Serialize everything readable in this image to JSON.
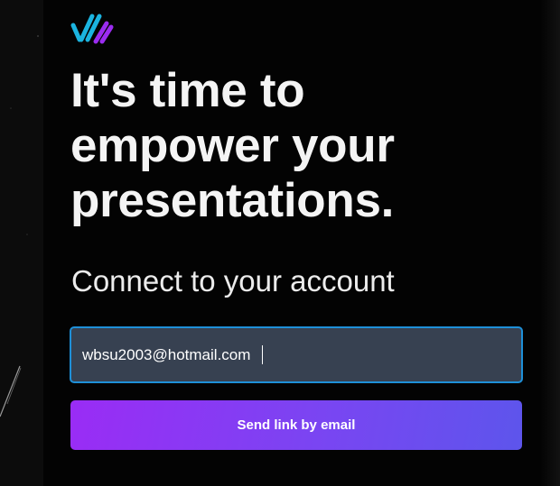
{
  "brand": {
    "logo_icon": "brand-stripes-logo-icon",
    "colors": {
      "primary_stripe": "#1bb4e0",
      "secondary_stripe": "#9b2cf0"
    }
  },
  "hero": {
    "headline_lines": [
      "It's time to",
      "empower your",
      "presentations."
    ]
  },
  "login": {
    "subtitle": "Connect to your account",
    "email_value": "wbsu2003@hotmail.com",
    "send_button_label": "Send link by email"
  },
  "colors": {
    "background": "#030303",
    "input_background": "#374151",
    "input_focus_border": "#1e90d8",
    "button_gradient_start": "#9a2cf5",
    "button_gradient_end": "#5d55ec",
    "text": "#f4f4f4"
  }
}
